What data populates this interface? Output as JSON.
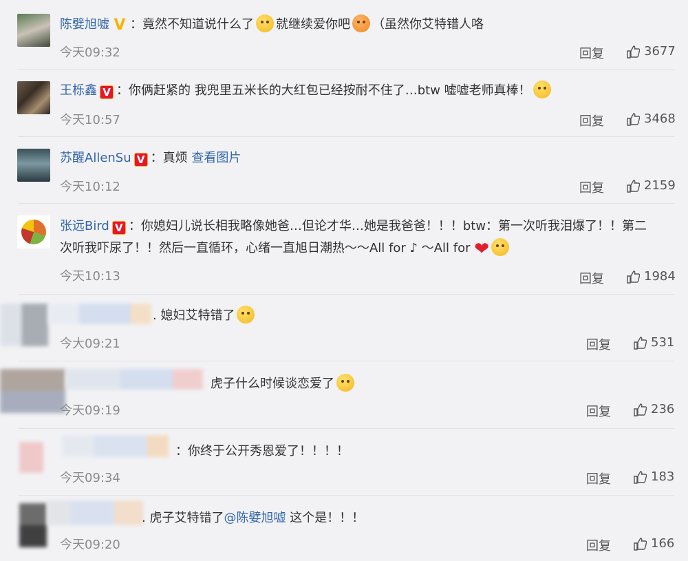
{
  "comments": [
    {
      "name": "陈嬖旭嘘",
      "badge": "V",
      "colon": "：",
      "text1": "竟然不知道说什么了",
      "text2": "就继续爱你吧",
      "text3": "（虽然你艾特错人咯",
      "time": "今天09:32",
      "reply": "回复",
      "likes": "3677"
    },
    {
      "name": "王栎鑫",
      "badge": "V",
      "colon": "：",
      "text1": "你俩赶紧的 我兜里五米长的大红包已经按耐不住了…btw 嘘嘘老师真棒！",
      "time": "今天10:57",
      "reply": "回复",
      "likes": "3468"
    },
    {
      "name": "苏醒AllenSu",
      "badge": "V",
      "colon": "：",
      "text1": "真烦",
      "link": "查看图片",
      "time": "今天10:12",
      "reply": "回复",
      "likes": "2159"
    },
    {
      "name": "张远Bird",
      "badge": "V",
      "colon": "：",
      "text1": "你媳妇儿说长相我略像她爸…但论才华…她是我爸爸！！！btw：第一次听我泪爆了！！第二",
      "text2": "次听我吓尿了！！然后一直循环，心绪一直旭日潮热～～All for ♪ ～All for",
      "time": "今天10:13",
      "reply": "回复",
      "likes": "1984"
    },
    {
      "colon": ".",
      "text1": "媳妇艾特错了",
      "time": "今大09:21",
      "reply": "回复",
      "likes": "531"
    },
    {
      "text1": "虎子什么时候谈恋爱了",
      "time": "今天09:19",
      "reply": "回复",
      "likes": "236"
    },
    {
      "colon": "：",
      "text1": "你终于公开秀恩爱了！！！！",
      "time": "今天09:34",
      "reply": "回复",
      "likes": "183"
    },
    {
      "colon": ".",
      "text1": "虎子艾特错了",
      "mention": "@陈嬖旭嘘",
      "text2": "这个是！！！",
      "time": "今天09:20",
      "reply": "回复",
      "likes": "166"
    }
  ]
}
